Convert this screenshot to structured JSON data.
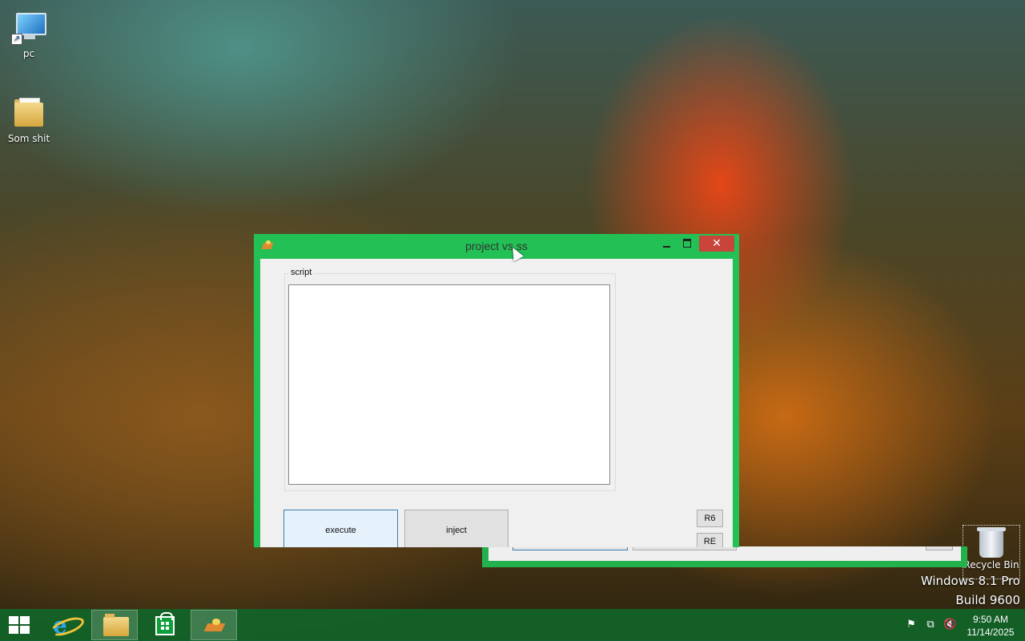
{
  "desktop": {
    "icons": [
      {
        "label": "pc",
        "icon": "computer-icon"
      },
      {
        "label": "Som shit",
        "icon": "folder-icon"
      }
    ],
    "recycle_bin": {
      "label": "Recycle Bin",
      "icon": "recycle-bin-icon"
    },
    "watermark": {
      "line1": "Windows 8.1 Pro",
      "line2": "Build 9600"
    }
  },
  "window": {
    "title": "project vs ss",
    "controls": {
      "minimize": "",
      "maximize": "",
      "close": "✕"
    },
    "group_label": "script",
    "script_value": "",
    "buttons": {
      "execute": "execute",
      "inject": "inject",
      "r6": "R6",
      "re": "RE"
    },
    "accent_color": "#22c055"
  },
  "taskbar": {
    "items": [
      {
        "name": "start",
        "icon": "windows-logo-icon"
      },
      {
        "name": "internet-explorer",
        "icon": "ie-icon"
      },
      {
        "name": "file-explorer",
        "icon": "folder-icon"
      },
      {
        "name": "store",
        "icon": "store-bag-icon"
      },
      {
        "name": "project-app",
        "icon": "app-icon",
        "active": true
      }
    ],
    "tray": [
      "flag-icon",
      "network-icon",
      "volume-muted-icon"
    ],
    "clock": {
      "time": "9:50 AM",
      "date": "11/14/2025"
    },
    "color": "#126428"
  }
}
